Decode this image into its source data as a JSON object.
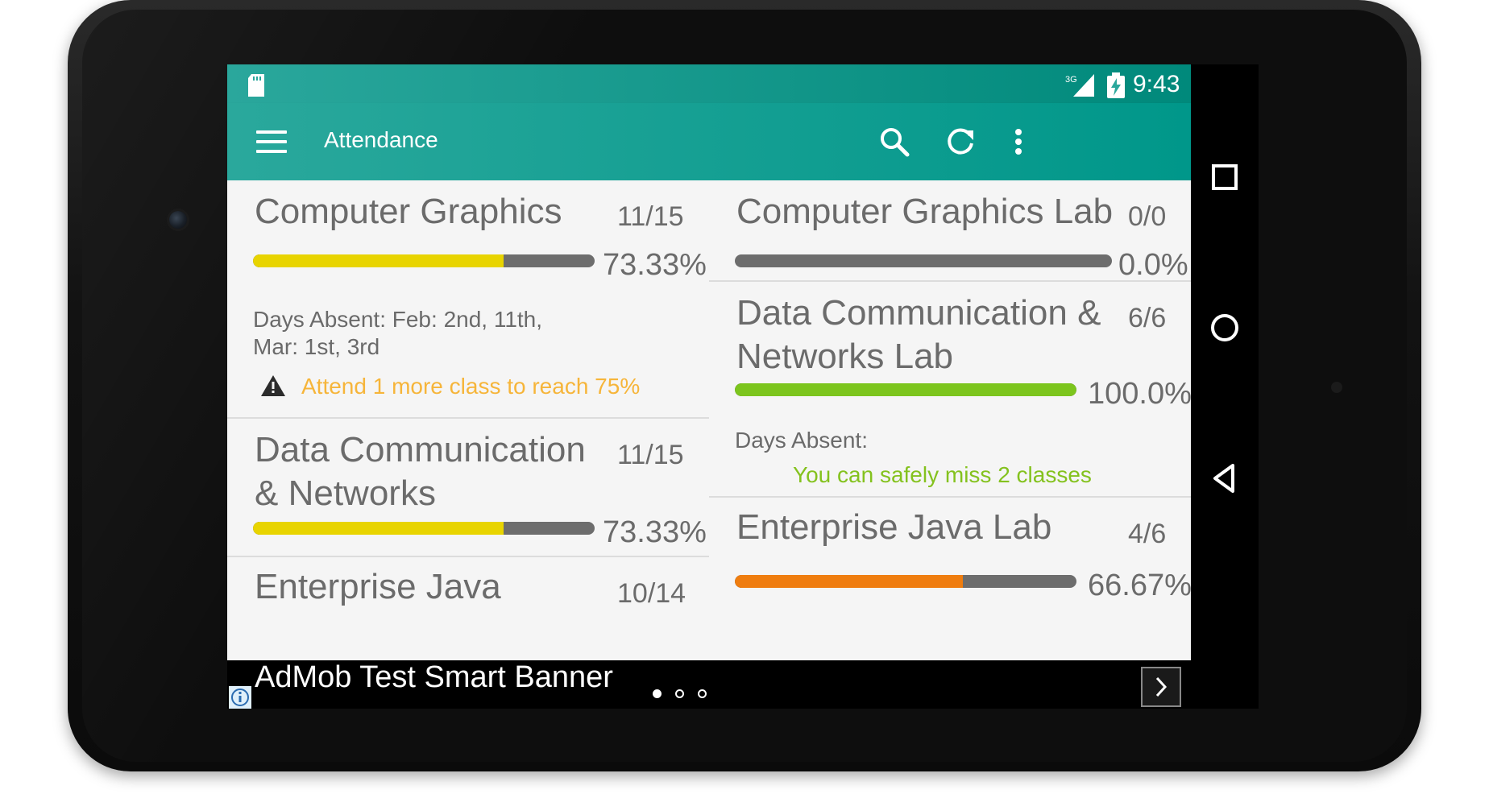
{
  "status_bar": {
    "network_label": "3G",
    "time": "9:43",
    "icons": [
      "sd-card-icon",
      "signal-3g-icon",
      "battery-charging-icon"
    ]
  },
  "app_bar": {
    "title": "Attendance",
    "icons": [
      "menu-icon",
      "search-icon",
      "refresh-icon",
      "overflow-menu-icon"
    ]
  },
  "subjects_left": [
    {
      "title": "Computer Graphics",
      "count": "11/15",
      "percent": "73.33%",
      "progress": 0.7333,
      "color": "#e8d400",
      "days_absent": "Days Absent: Feb: 2nd, 11th,\nMar: 1st, 3rd",
      "status_note": "Attend 1 more class to reach 75%"
    },
    {
      "title": "Data Communication & Networks",
      "count": "11/15",
      "percent": "73.33%",
      "progress": 0.7333,
      "color": "#e8d400"
    },
    {
      "title": "Enterprise Java",
      "count": "10/14"
    }
  ],
  "subjects_right": [
    {
      "title": "Computer Graphics Lab",
      "count": "0/0",
      "percent": "0.0%",
      "progress": 0.0
    },
    {
      "title": "Data Communication & Networks Lab",
      "count": "6/6",
      "percent": "100.0%",
      "progress": 1.0,
      "color": "#7cc51d",
      "days_absent": "Days Absent:",
      "status_note": "You can safely miss 2 classes"
    },
    {
      "title": "Enterprise Java Lab",
      "count": "4/6",
      "percent": "66.67%",
      "progress": 0.6667,
      "color": "#ef7d0f"
    }
  ],
  "ad_banner": {
    "text": "AdMob Test Smart Banner",
    "pages": 3,
    "active_page": 1
  },
  "colors": {
    "primary": "#009688",
    "warning": "#f6b53a",
    "safe": "#84c21e"
  }
}
